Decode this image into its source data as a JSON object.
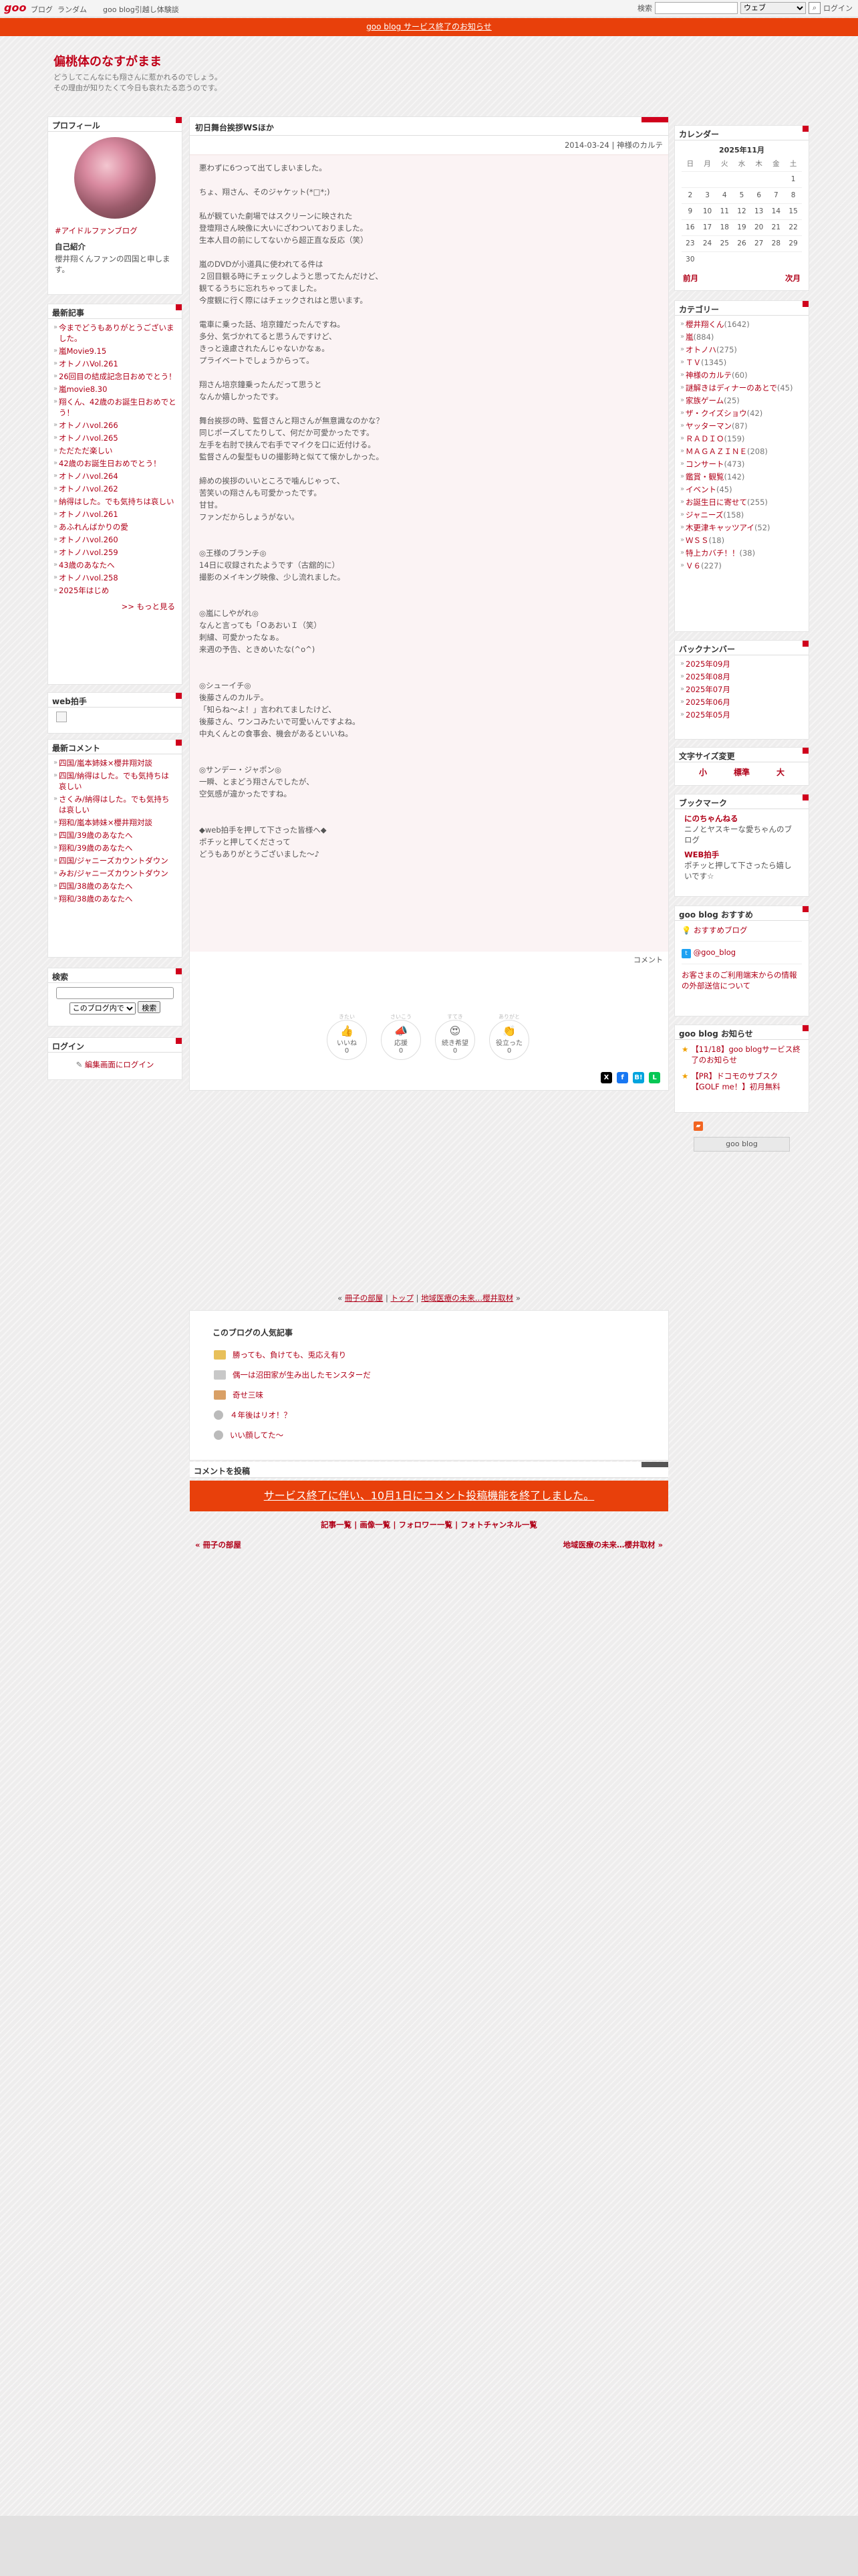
{
  "topbar": {
    "logo": "goo",
    "links": [
      "ブログ",
      "ランダム",
      "goo blog引越し体験談"
    ],
    "search_label": "検索",
    "search_placeholder": "",
    "search_scope": "ウェブ",
    "login": "ログイン"
  },
  "notice": "goo blog サービス終了のお知らせ",
  "blog": {
    "title": "偏桃体のなすがまま",
    "description_lines": [
      "どうしてこんなにも翔さんに惹かれるのでしょう。",
      "その理由が知りたくて今日も哀れたる恋うのです。"
    ]
  },
  "profile": {
    "heading": "プロフィール",
    "link": "#アイドルファンブログ",
    "intro_title": "自己紹介",
    "intro_text": "櫻井翔くんファンの四国と申します。"
  },
  "recent_articles": {
    "heading": "最新記事",
    "items": [
      "今までどうもありがとうございました。",
      "嵐Movie9.15",
      "オトノハVol.261",
      "26回目の結成記念日おめでとう！",
      "嵐movie8.30",
      "翔くん、42歳のお誕生日おめでとう！",
      "オトノハvol.266",
      "オトノハvol.265",
      "ただただ楽しい",
      "42歳のお誕生日おめでとう！",
      "オトノハvol.264",
      "オトノハvol.262",
      "納得はした。でも気持ちは哀しい",
      "オトノハvol.261",
      "あふれんばかりの愛",
      "オトノハvol.260",
      "オトノハvol.259",
      "43歳のあなたへ",
      "オトノハvol.258",
      "2025年はじめ"
    ],
    "more": ">> もっと見る"
  },
  "web_clap": {
    "heading": "web拍手"
  },
  "recent_comments": {
    "heading": "最新コメント",
    "items": [
      "四国/嵐本姉妹×櫻井翔対談",
      "四国/納得はした。でも気持ちは哀しい",
      "さくみ/納得はした。でも気持ちは哀しい",
      "翔和/嵐本姉妹×櫻井翔対談",
      "四国/39歳のあなたへ",
      "翔和/39歳のあなたへ",
      "四国/ジャニーズカウントダウン",
      "みお/ジャニーズカウントダウン",
      "四国/38歳のあなたへ",
      "翔和/38歳のあなたへ"
    ]
  },
  "search_box": {
    "heading": "検索",
    "scope": "このブログ内で",
    "button": "検索"
  },
  "login_box": {
    "heading": "ログイン",
    "link": "編集画面にログイン"
  },
  "entry": {
    "title": "初日舞台挨拶WSほか",
    "date": "2014-03-24 | 神様のカルテ",
    "paragraphs": [
      "悪わずに6つって出てしまいました。",
      "",
      "ちょ、翔さん、そのジャケット(*□*;)",
      "",
      "私が観ていた劇場ではスクリーンに映された",
      "登壇翔さん映像に大いにざわついておりました。",
      "生本人目の前にしてないから超正直な反応（笑）",
      "",
      "嵐のDVDが小道具に使われてる件は",
      "２回目観る時にチェックしようと思ってたんだけど、",
      "観てるうちに忘れちゃってました。",
      "今度観に行く際にはチェックされはと思います。",
      "",
      "電車に乗った話、培京鐘だったんですね。",
      "多分、気づかれてると思うんですけど、",
      "きっと遠慮されたんじゃないかなぁ。",
      "プライベートでしょうからって。",
      "",
      "翔さん培京鐘乗ったんだって思うと",
      "なんか嬉しかったです。",
      "",
      "舞台挨拶の時、監督さんと翔さんが無意識なのかな？",
      "同じポーズしてたりして、何だか可愛かったです。",
      "左手を右肘で挟んで右手でマイクを口に近付ける。",
      "監督さんの髪型もＵの撮影時と似てて懐かしかった。",
      "",
      "締めの挨拶のいいところで噛んじゃって、",
      "苦笑いの翔さんも可愛かったです。",
      "甘甘。",
      "ファンだからしょうがない。",
      "",
      "",
      "◎王様のブランチ◎",
      "14日に収録されたようです（古舘的に）",
      "撮影のメイキング映像、少し流れました。",
      "",
      "",
      "◎嵐にしやがれ◎",
      "なんと言っても「ＯあおいＩ（笑）",
      "刺繍、可愛かったなぁ。",
      "来週の予告、ときめいたな(^o^)",
      "",
      "",
      "◎シューイチ◎",
      "後藤さんのカルテ。",
      "「知らね～よ！」言われてましたけど、",
      "後藤さん、ワンコみたいで可愛いんですよね。",
      "中丸くんとの食事会、機会があるといいね。",
      "",
      "",
      "◎サンデー・ジャポン◎",
      "一瞬、とまどう翔さんでしたが、",
      "空気感が違かったですね。",
      "",
      "",
      "◆web拍手を押して下さった皆様へ◆",
      "ポチッと押してくださって",
      "どうもありがとうございました～♪"
    ],
    "comment_link": "コメント",
    "reactions": [
      {
        "top": "きたい",
        "emoji": "👍",
        "label": "いいね",
        "count": "0"
      },
      {
        "top": "さいこう",
        "emoji": "📣",
        "label": "応援",
        "count": "0"
      },
      {
        "top": "すてき",
        "emoji": "😍",
        "label": "続き希望",
        "count": "0"
      },
      {
        "top": "ありがと",
        "emoji": "👏",
        "label": "役立った",
        "count": "0"
      }
    ],
    "share": [
      {
        "name": "X",
        "color": "#000000"
      },
      {
        "name": "f",
        "color": "#1877f2"
      },
      {
        "name": "B!",
        "color": "#00a4de"
      },
      {
        "name": "L",
        "color": "#06c755"
      }
    ]
  },
  "topnav": {
    "items": [
      "冊子の部屋",
      "トップ",
      "地域医療の未来…櫻井取材"
    ]
  },
  "popular": {
    "heading": "このブログの人気記事",
    "items": [
      "勝っても、負けても、兎応え有り",
      "偶一は沼田家が生み出したモンスターだ",
      "奇せ三味",
      "４年後はリオ！？",
      "いい顔してた～"
    ],
    "badge_colors": [
      "#e8c05a",
      "#c8c8c8",
      "#d9a066",
      "#bbbbbb",
      "#bbbbbb"
    ]
  },
  "comment_section": {
    "heading": "コメントを投稿",
    "notice": "サービス終了に伴い、10月1日にコメント投稿機能を終了しました。"
  },
  "bottom_links": [
    "記事一覧",
    "画像一覧",
    "フォロワー一覧",
    "フォトチャンネル一覧"
  ],
  "pager": {
    "prev": "冊子の部屋",
    "next": "地域医療の未来…櫻井取材"
  },
  "calendar": {
    "heading": "カレンダー",
    "month": "2025年11月",
    "weekdays": [
      "日",
      "月",
      "火",
      "水",
      "木",
      "金",
      "土"
    ],
    "weeks": [
      [
        "",
        "",
        "",
        "",
        "",
        "",
        "1"
      ],
      [
        "2",
        "3",
        "4",
        "5",
        "6",
        "7",
        "8"
      ],
      [
        "9",
        "10",
        "11",
        "12",
        "13",
        "14",
        "15"
      ],
      [
        "16",
        "17",
        "18",
        "19",
        "20",
        "21",
        "22"
      ],
      [
        "23",
        "24",
        "25",
        "26",
        "27",
        "28",
        "29"
      ],
      [
        "30",
        "",
        "",
        "",
        "",
        "",
        ""
      ]
    ],
    "prev": "前月",
    "next": "次月"
  },
  "categories": {
    "heading": "カテゴリー",
    "items": [
      {
        "name": "櫻井翔くん",
        "count": "(1642)"
      },
      {
        "name": "嵐",
        "count": "(884)"
      },
      {
        "name": "オトノハ",
        "count": "(275)"
      },
      {
        "name": "ＴＶ",
        "count": "(1345)"
      },
      {
        "name": "神様のカルテ",
        "count": "(60)"
      },
      {
        "name": "謎解きはディナーのあとで",
        "count": "(45)"
      },
      {
        "name": "家族ゲーム",
        "count": "(25)"
      },
      {
        "name": "ザ・クイズショウ",
        "count": "(42)"
      },
      {
        "name": "ヤッターマン",
        "count": "(87)"
      },
      {
        "name": "ＲＡＤＩＯ",
        "count": "(159)"
      },
      {
        "name": "ＭＡＧＡＺＩＮＥ",
        "count": "(208)"
      },
      {
        "name": "コンサート",
        "count": "(473)"
      },
      {
        "name": "鑑賞・観覧",
        "count": "(142)"
      },
      {
        "name": "イベント",
        "count": "(45)"
      },
      {
        "name": "お誕生日に寄せて",
        "count": "(255)"
      },
      {
        "name": "ジャニーズ",
        "count": "(158)"
      },
      {
        "name": "木更津キャッツアイ",
        "count": "(52)"
      },
      {
        "name": "ＷＳＳ",
        "count": "(18)"
      },
      {
        "name": "特上カバチ！！",
        "count": "(38)"
      },
      {
        "name": "Ｖ６",
        "count": "(227)"
      }
    ]
  },
  "backnumber": {
    "heading": "バックナンバー",
    "items": [
      "2025年09月",
      "2025年08月",
      "2025年07月",
      "2025年06月",
      "2025年05月"
    ]
  },
  "fontsize": {
    "heading": "文字サイズ変更",
    "items": [
      "小",
      "標準",
      "大"
    ]
  },
  "bookmark": {
    "heading": "ブックマーク",
    "items": [
      {
        "title": "にのちゃんねる",
        "desc": "ニノとヤスキーな愛ちゃんのブログ"
      },
      {
        "title": "WEB拍手",
        "desc": "ポチッと押して下さったら嬉しいです☆"
      }
    ]
  },
  "osusume": {
    "heading": "goo blog おすすめ",
    "items": [
      "おすすめブログ",
      "@goo_blog"
    ],
    "notice": "お客さまのご利用端末からの情報の外部送信について"
  },
  "oshirase": {
    "heading": "goo blog お知らせ",
    "items": [
      "【11/18】goo blogサービス終了のお知らせ",
      "【PR】ドコモのサブスク【GOLF me！】初月無料"
    ]
  },
  "footer_badge": "goo blog"
}
